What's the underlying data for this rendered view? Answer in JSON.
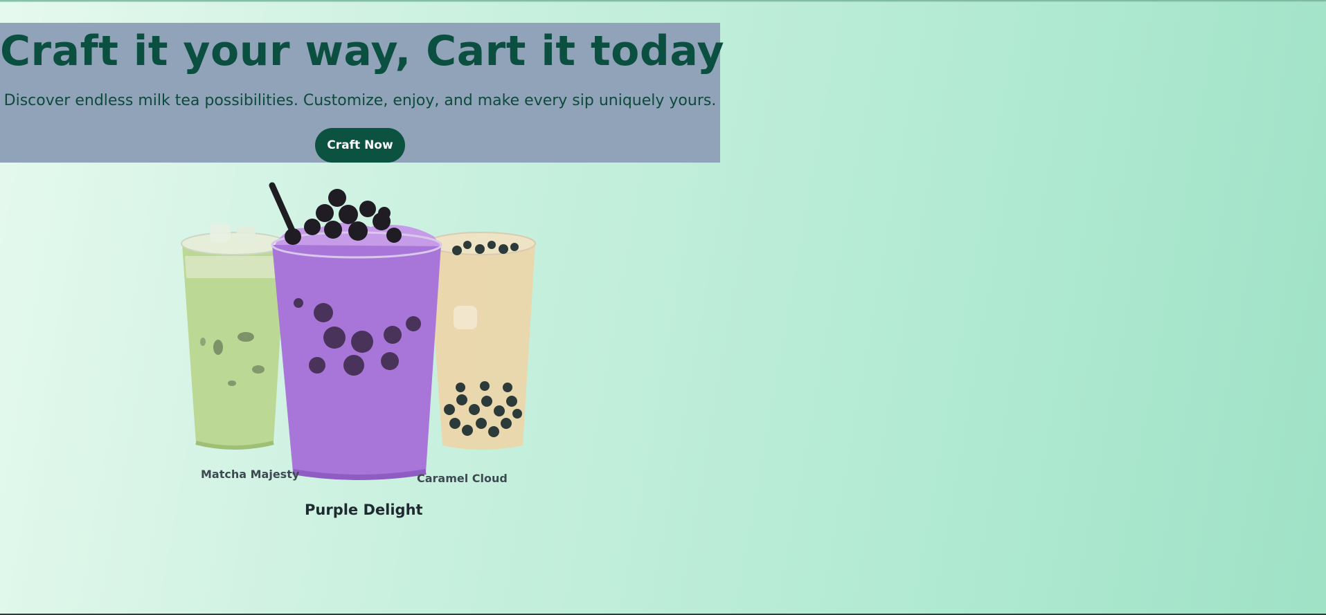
{
  "hero": {
    "title": "Craft it your way, Cart it today",
    "subtitle": "Discover endless milk tea possibilities. Customize, enjoy, and make every sip uniquely yours.",
    "cta_label": "Craft Now"
  },
  "products": [
    {
      "name": "Matcha Majesty",
      "color": "#b6d48e"
    },
    {
      "name": "Purple Delight",
      "color": "#a774d6"
    },
    {
      "name": "Caramel Cloud",
      "color": "#e8d2a4"
    }
  ],
  "colors": {
    "accent": "#0c5240",
    "hero_bg": "#91a3b8",
    "title": "#0a4f3f"
  }
}
